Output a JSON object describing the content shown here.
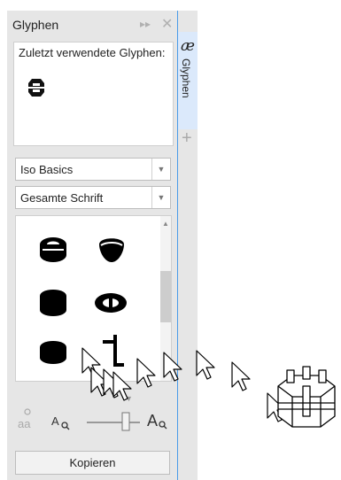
{
  "panel": {
    "title": "Glyphen",
    "expand_icon": "▸▸",
    "close_icon": "✕"
  },
  "recent": {
    "label": "Zuletzt verwendete Glyphen:"
  },
  "font_select": {
    "value": "Iso Basics"
  },
  "subset_select": {
    "value": "Gesamte Schrift"
  },
  "side_tab": {
    "icon": "æ",
    "label": "Glyphen",
    "add_icon": "+"
  },
  "copy": {
    "label": "Kopieren"
  },
  "colors": {
    "accent": "#4a9be8",
    "panel_bg": "#e6e6e6",
    "tab_bg": "#dbe9fb"
  }
}
